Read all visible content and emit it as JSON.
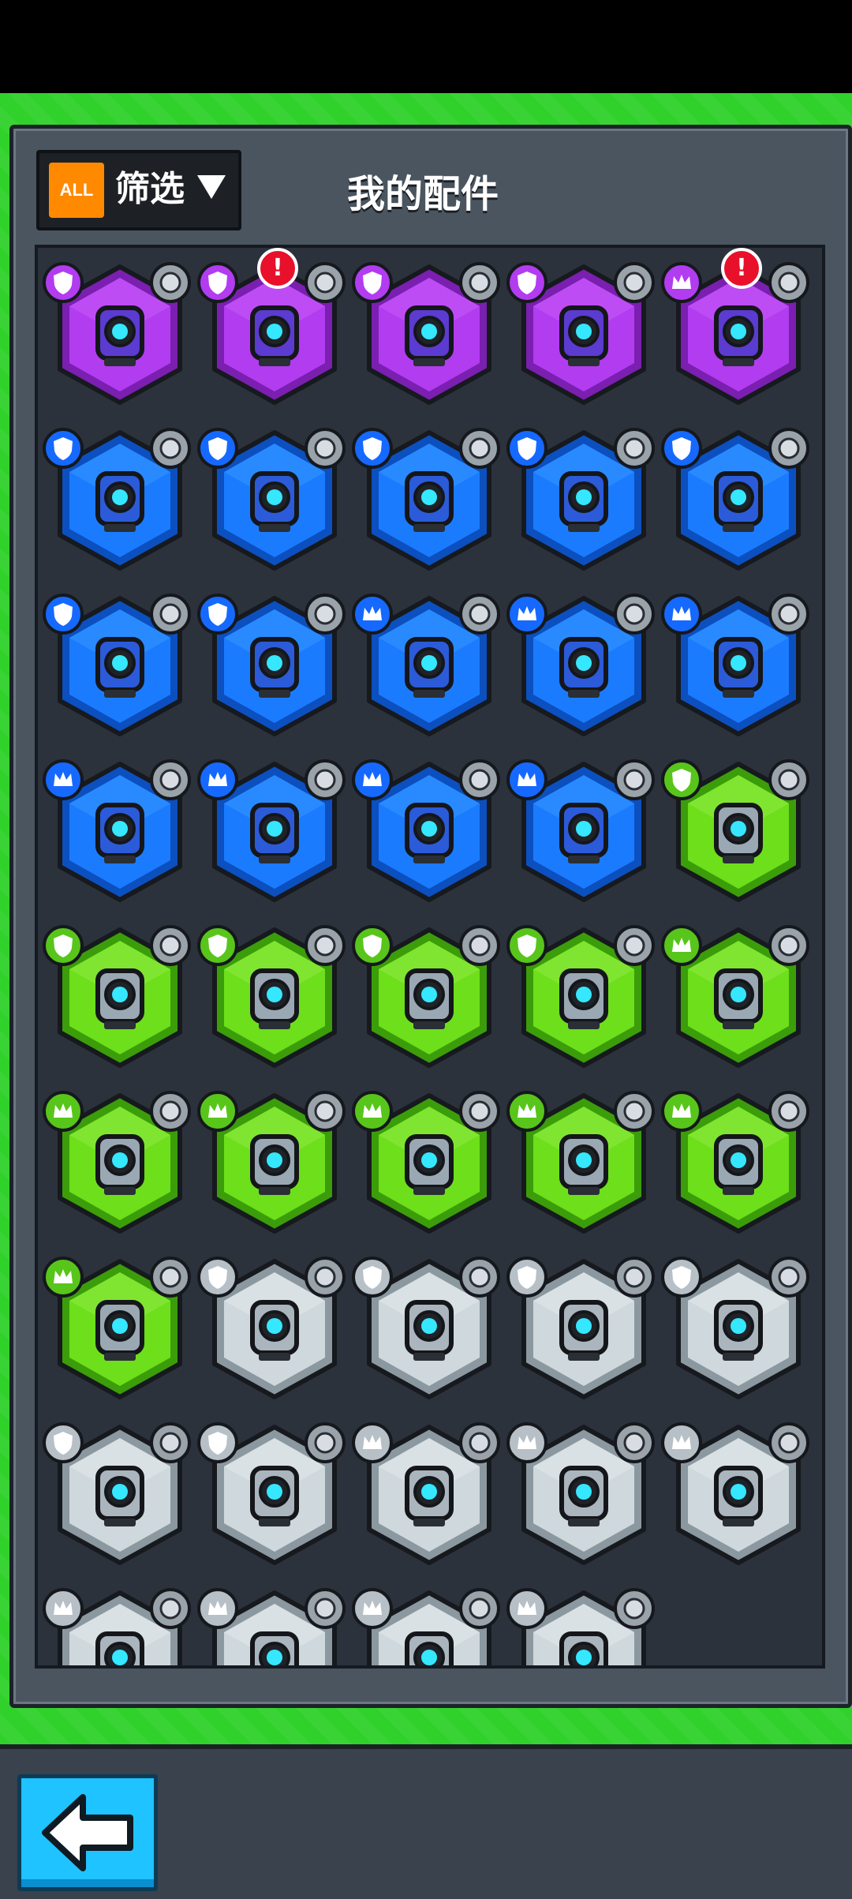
{
  "header": {
    "all_badge": "ALL",
    "filter_label": "筛选",
    "title": "我的配件"
  },
  "colors": {
    "rarity_purple": "#b23cf0",
    "rarity_blue": "#1b7bff",
    "rarity_green": "#6ddf1b",
    "rarity_gray": "#cfd8dc"
  },
  "parts": [
    {
      "rarity": "purple",
      "icon": "shield-wing-part-icon",
      "badge": "shield",
      "type": "rocket",
      "alert": false
    },
    {
      "rarity": "purple",
      "icon": "capsule-part-icon",
      "badge": "shield",
      "type": "flower",
      "alert": true
    },
    {
      "rarity": "purple",
      "icon": "twin-eye-part-icon",
      "badge": "shield",
      "type": "arc",
      "alert": false
    },
    {
      "rarity": "purple",
      "icon": "walker-pod-part-icon",
      "badge": "shield",
      "type": "virus",
      "alert": false
    },
    {
      "rarity": "purple",
      "icon": "triangle-core-part-icon",
      "badge": "crown",
      "type": "bottle",
      "alert": true
    },
    {
      "rarity": "blue",
      "icon": "shield-wing-part-icon",
      "badge": "shield",
      "type": "leaf",
      "alert": false
    },
    {
      "rarity": "blue",
      "icon": "shield-wing-part-icon",
      "badge": "shield",
      "type": "leaf",
      "alert": false
    },
    {
      "rarity": "blue",
      "icon": "blade-plate-part-icon",
      "badge": "shield",
      "type": "target",
      "alert": false
    },
    {
      "rarity": "blue",
      "icon": "twin-tank-part-icon",
      "badge": "shield",
      "type": "brick",
      "alert": false
    },
    {
      "rarity": "blue",
      "icon": "twin-tank-part-icon",
      "badge": "shield",
      "type": "brick",
      "alert": false
    },
    {
      "rarity": "blue",
      "icon": "walker-pod-part-icon",
      "badge": "shield",
      "type": "spike",
      "alert": false
    },
    {
      "rarity": "blue",
      "icon": "walker-pod-part-icon",
      "badge": "shield",
      "type": "spike",
      "alert": false
    },
    {
      "rarity": "blue",
      "icon": "camera-part-icon",
      "badge": "crown",
      "type": "shell",
      "alert": false
    },
    {
      "rarity": "blue",
      "icon": "camera-part-icon",
      "badge": "crown",
      "type": "shell",
      "alert": false
    },
    {
      "rarity": "blue",
      "icon": "box-core-part-icon",
      "badge": "crown",
      "type": "cone",
      "alert": false
    },
    {
      "rarity": "blue",
      "icon": "ring-core-part-icon",
      "badge": "crown",
      "type": "ball",
      "alert": false
    },
    {
      "rarity": "blue",
      "icon": "arm-lens-part-icon",
      "badge": "crown",
      "type": "can",
      "alert": false
    },
    {
      "rarity": "blue",
      "icon": "twin-cannon-part-icon",
      "badge": "crown",
      "type": "bag",
      "alert": false
    },
    {
      "rarity": "blue",
      "icon": "triangle-core-part-icon",
      "badge": "crown",
      "type": "bottle",
      "alert": false
    },
    {
      "rarity": "green",
      "icon": "shield-wing-part-icon",
      "badge": "shield",
      "type": "leaf",
      "alert": false
    },
    {
      "rarity": "green",
      "icon": "capsule-part-icon",
      "badge": "shield",
      "type": "rock",
      "alert": false
    },
    {
      "rarity": "green",
      "icon": "blade-plate-part-icon",
      "badge": "shield",
      "type": "target",
      "alert": false
    },
    {
      "rarity": "green",
      "icon": "twin-tank-part-icon",
      "badge": "shield",
      "type": "brick",
      "alert": false
    },
    {
      "rarity": "green",
      "icon": "box-lens-part-icon",
      "badge": "shield",
      "type": "arc",
      "alert": false
    },
    {
      "rarity": "green",
      "icon": "box-core-part-icon",
      "badge": "crown",
      "type": "cone",
      "alert": false
    },
    {
      "rarity": "green",
      "icon": "box-core-part-icon",
      "badge": "crown",
      "type": "cone",
      "alert": false
    },
    {
      "rarity": "green",
      "icon": "ring-core-part-icon",
      "badge": "crown",
      "type": "ball",
      "alert": false
    },
    {
      "rarity": "green",
      "icon": "ring-core-part-icon",
      "badge": "crown",
      "type": "ball",
      "alert": false
    },
    {
      "rarity": "green",
      "icon": "lens-turret-part-icon",
      "badge": "crown",
      "type": "can",
      "alert": false
    },
    {
      "rarity": "green",
      "icon": "lens-turret-part-icon",
      "badge": "crown",
      "type": "can",
      "alert": false
    },
    {
      "rarity": "green",
      "icon": "twin-cannon-part-icon",
      "badge": "crown",
      "type": "bag",
      "alert": false
    },
    {
      "rarity": "gray",
      "icon": "shard-part-icon",
      "badge": "shield",
      "type": "leaf",
      "alert": false
    },
    {
      "rarity": "gray",
      "icon": "shard-part-icon",
      "badge": "shield",
      "type": "leaf",
      "alert": false
    },
    {
      "rarity": "gray",
      "icon": "capsule-part-icon",
      "badge": "shield",
      "type": "rock",
      "alert": false
    },
    {
      "rarity": "gray",
      "icon": "twin-tank-part-icon",
      "badge": "shield",
      "type": "brick",
      "alert": false
    },
    {
      "rarity": "gray",
      "icon": "twin-tank-part-icon",
      "badge": "shield",
      "type": "brick",
      "alert": false
    },
    {
      "rarity": "gray",
      "icon": "dome-part-icon",
      "badge": "shield",
      "type": "spike",
      "alert": false
    },
    {
      "rarity": "gray",
      "icon": "camera-part-icon",
      "badge": "crown",
      "type": "shell",
      "alert": false
    },
    {
      "rarity": "gray",
      "icon": "box-core-part-icon",
      "badge": "crown",
      "type": "cone",
      "alert": false
    },
    {
      "rarity": "gray",
      "icon": "ring-core-part-icon",
      "badge": "crown",
      "type": "ball",
      "alert": false
    },
    {
      "rarity": "gray",
      "icon": "twin-cannon-part-icon",
      "badge": "crown",
      "type": "bag",
      "alert": false
    },
    {
      "rarity": "gray",
      "icon": "twin-cannon-part-icon",
      "badge": "crown",
      "type": "bag",
      "alert": false
    },
    {
      "rarity": "gray",
      "icon": "triangle-core-part-icon",
      "badge": "crown",
      "type": "bottle",
      "alert": false
    },
    {
      "rarity": "gray",
      "icon": "triangle-core-part-icon",
      "badge": "crown",
      "type": "bottle",
      "alert": false
    }
  ]
}
